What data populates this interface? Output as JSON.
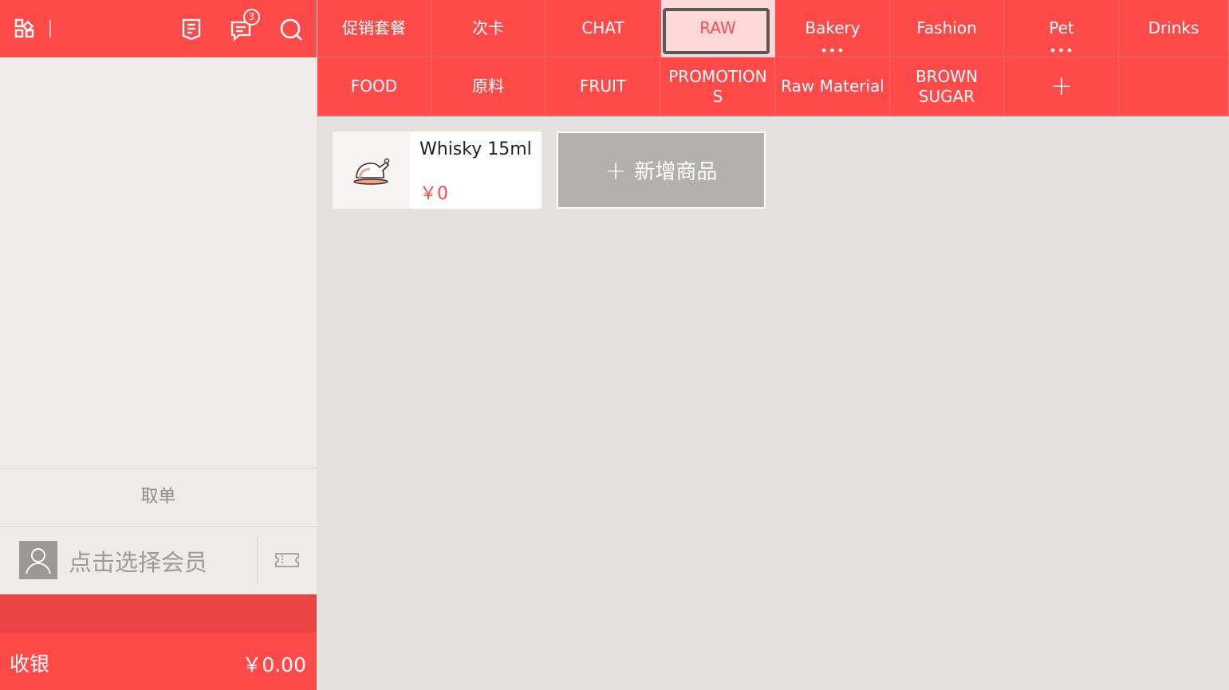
{
  "topbar": {
    "message_badge": "3"
  },
  "cart": {
    "take_order_label": "取单",
    "member_placeholder": "点击选择会员",
    "checkout_label": "收银",
    "checkout_total": "￥0.00"
  },
  "categories": [
    {
      "label": "促销套餐"
    },
    {
      "label": "次卡"
    },
    {
      "label": "CHAT"
    },
    {
      "label": "RAW"
    },
    {
      "label": "Bakery"
    },
    {
      "label": "Fashion"
    },
    {
      "label": "Pet"
    },
    {
      "label": "Drinks"
    },
    {
      "label": "FOOD"
    },
    {
      "label": "原料"
    },
    {
      "label": "FRUIT"
    },
    {
      "label": "PROMOTION S"
    },
    {
      "label": "Raw Material"
    },
    {
      "label": "BROWN SUGAR"
    },
    {
      "label": "+"
    }
  ],
  "products": [
    {
      "name": "Whisky 15ml",
      "price": "￥0",
      "icon": "roast-chicken-icon"
    }
  ],
  "add_product_label": "新增商品",
  "colors": {
    "brand_red": "#ff4a4a",
    "active_tab_bg": "#ffd9d9",
    "panel_bg": "#f0eceb",
    "content_bg": "#e5e1df"
  }
}
